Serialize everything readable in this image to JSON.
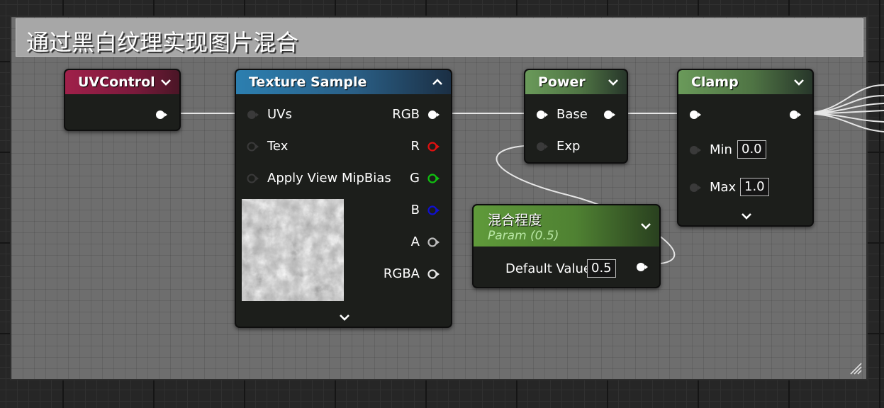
{
  "comment": {
    "title": "通过黑白纹理实现图片混合"
  },
  "nodes": {
    "uv_control": {
      "title": "UVControl"
    },
    "texture_sample": {
      "title": "Texture Sample",
      "inputs": [
        "UVs",
        "Tex",
        "Apply View MipBias"
      ],
      "outputs": [
        "RGB",
        "R",
        "G",
        "B",
        "A",
        "RGBA"
      ]
    },
    "power": {
      "title": "Power",
      "inputs": [
        "Base",
        "Exp"
      ]
    },
    "clamp": {
      "title": "Clamp",
      "min_label": "Min",
      "min_value": "0.0",
      "max_label": "Max",
      "max_value": "1.0"
    },
    "param": {
      "title": "混合程度",
      "subtitle": "Param (0.5)",
      "default_label": "Default Value",
      "default_value": "0.5"
    }
  },
  "colors": {
    "pin_white": "#ffffff",
    "pin_red": "#e01010",
    "pin_green": "#10c010",
    "pin_blue": "#1010d0",
    "pin_gray": "#bdbdbd",
    "wire": "#e6e6e6"
  },
  "icons": [
    "chevron-down-icon",
    "chevron-up-icon",
    "resize-grip-icon",
    "pin-connector-icon"
  ]
}
